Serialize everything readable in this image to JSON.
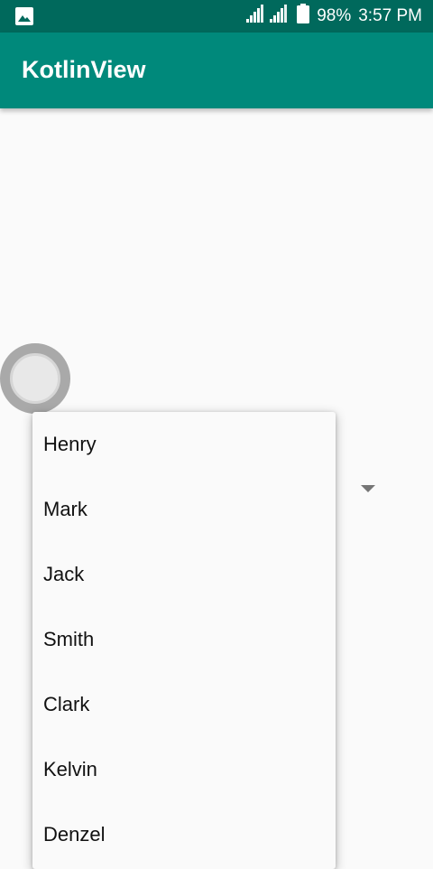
{
  "status_bar": {
    "left_icon": "image-icon",
    "battery_percent": "98%",
    "time": "3:57 PM"
  },
  "app_bar": {
    "title": "KotlinView"
  },
  "spinner": {
    "options": [
      "Henry",
      "Mark",
      "Jack",
      "Smith",
      "Clark",
      "Kelvin",
      "Denzel"
    ]
  },
  "colors": {
    "status_bar": "#00695c",
    "app_bar": "#00897b",
    "background": "#fafafa"
  }
}
